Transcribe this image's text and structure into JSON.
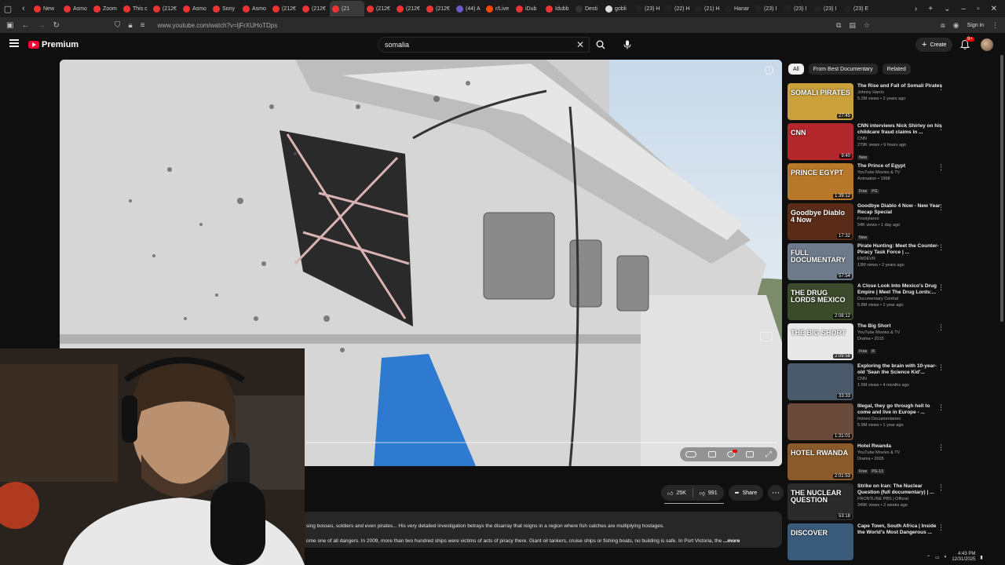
{
  "browser": {
    "tabs": [
      {
        "label": "New",
        "color": "#e33"
      },
      {
        "label": "Asmo",
        "color": "#e33"
      },
      {
        "label": "Zoom",
        "color": "#e33"
      },
      {
        "label": "This c",
        "color": "#e33"
      },
      {
        "label": "(212€",
        "color": "#e33"
      },
      {
        "label": "Asmo",
        "color": "#e33"
      },
      {
        "label": "Sony",
        "color": "#e33"
      },
      {
        "label": "Asmo",
        "color": "#e33"
      },
      {
        "label": "(212€",
        "color": "#e33"
      },
      {
        "label": "(212€",
        "color": "#e33"
      },
      {
        "label": "(21",
        "color": "#e33",
        "active": true
      },
      {
        "label": "(212€",
        "color": "#e33"
      },
      {
        "label": "(212€",
        "color": "#e33"
      },
      {
        "label": "(212€",
        "color": "#e33"
      },
      {
        "label": "(44) A",
        "color": "#6a5acd"
      },
      {
        "label": "r/Live",
        "color": "#ff4500"
      },
      {
        "label": "iDub",
        "color": "#e33"
      },
      {
        "label": "Idubb",
        "color": "#e33"
      },
      {
        "label": "Desti",
        "color": "#333"
      },
      {
        "label": "gobli",
        "color": "#ddd"
      },
      {
        "label": "(23) H",
        "color": "#222"
      },
      {
        "label": "(22) H",
        "color": "#222"
      },
      {
        "label": "(21) H",
        "color": "#222"
      },
      {
        "label": "Hanar",
        "color": "#222"
      },
      {
        "label": "(23) I",
        "color": "#222"
      },
      {
        "label": "(23) I",
        "color": "#222"
      },
      {
        "label": "(23) I",
        "color": "#222"
      },
      {
        "label": "(23) E",
        "color": "#222"
      }
    ],
    "url": "www.youtube.com/watch?v=ljFrXUHoTDps",
    "signin": "Sign in"
  },
  "masthead": {
    "logo": "Premium",
    "search_value": "somalia",
    "create": "Create",
    "notifications": "9+"
  },
  "player": {
    "info": "i"
  },
  "actions": {
    "likes": "25K",
    "dislikes": "991",
    "share": "Share"
  },
  "description": {
    "line1": "sing bosses, soldiers and even pirates... His very detailed investigation betrays the disarray that reigns in a region where fish catches are multiplying hostages.",
    "line2": "ome one of all dangers. In 2009, more than two hundred ships were victims of acts of piracy there. Giant oil tankers, cruise ships or fishing boats, no building is safe. In Port Victoria, the",
    "more": "...more"
  },
  "chips": [
    "All",
    "From Best Documentary",
    "Related"
  ],
  "recommendations": [
    {
      "title": "The Rise and Fall of Somali Pirates",
      "channel": "Johnny Harris",
      "meta": "5.2M views • 2 years ago",
      "duration": "27:45",
      "badges": [],
      "thumb_text": "SOMALI PIRATES",
      "thumb_bg": "#c9a03a"
    },
    {
      "title": "CNN interviews Nick Shirley on his childcare fraud claims in ...",
      "channel": "CNN",
      "meta": "279K views • 9 hours ago",
      "duration": "9:40",
      "badges": [
        "New"
      ],
      "thumb_text": "CNN",
      "thumb_bg": "#b3262b"
    },
    {
      "title": "The Prince of Egypt",
      "channel": "YouTube Movies & TV",
      "meta": "Animation • 1998",
      "duration": "1:39:12",
      "badges": [
        "Free",
        "PG"
      ],
      "thumb_text": "PRINCE EGYPT",
      "thumb_bg": "#b8782a"
    },
    {
      "title": "Goodbye Diablo 4 Now - New Year Recap Special",
      "channel": "Frostylaroo",
      "meta": "54K views • 1 day ago",
      "duration": "17:32",
      "badges": [
        "New"
      ],
      "thumb_text": "Goodbye Diablo 4 Now",
      "thumb_bg": "#5a2b18"
    },
    {
      "title": "Pirate Hunting: Meet the Counter-Piracy Task Force | ...",
      "channel": "ENDEVR",
      "meta": "13M views • 2 years ago",
      "duration": "57:54",
      "badges": [],
      "thumb_text": "FULL DOCUMENTARY",
      "thumb_bg": "#6d7a8a"
    },
    {
      "title": "A Close Look Into Mexico's Drug Empire | Meet The Drug Lords:...",
      "channel": "Documentary Central",
      "meta": "5.8M views • 1 year ago",
      "duration": "2:08:12",
      "badges": [],
      "thumb_text": "THE DRUG LORDS MEXICO",
      "thumb_bg": "#3b4a2a"
    },
    {
      "title": "The Big Short",
      "channel": "YouTube Movies & TV",
      "meta": "Drama • 2015",
      "duration": "2:09:58",
      "badges": [
        "Free",
        "R"
      ],
      "thumb_text": "THE BIG SHORT",
      "thumb_bg": "#e8e8e8"
    },
    {
      "title": "Exploring the brain with 10-year-old 'Sean the Science Kid'...",
      "channel": "CNN",
      "meta": "1.6M views • 4 months ago",
      "duration": "33:33",
      "badges": [],
      "thumb_text": "",
      "thumb_bg": "#4a5a6a"
    },
    {
      "title": "Illegal, they go through hell to come and live in Europe - ...",
      "channel": "Imineo Documentaries",
      "meta": "5.9M views • 1 year ago",
      "duration": "1:31:01",
      "badges": [],
      "thumb_text": "",
      "thumb_bg": "#6a4a3a"
    },
    {
      "title": "Hotel Rwanda",
      "channel": "YouTube Movies & TV",
      "meta": "Drama • 2005",
      "duration": "2:01:53",
      "badges": [
        "Free",
        "PG-13"
      ],
      "thumb_text": "HOTEL RWANDA",
      "thumb_bg": "#8a5a2a"
    },
    {
      "title": "Strike on Iran: The Nuclear Question (full documentary) | ...",
      "channel": "FRONTLINE PBS | Official",
      "meta": "349K views • 2 weeks ago",
      "duration": "53:18",
      "badges": [],
      "thumb_text": "THE NUCLEAR QUESTION",
      "thumb_bg": "#2a2a2a"
    },
    {
      "title": "Cape Town, South Africa | Inside the World's Most Dangerous ...",
      "channel": "",
      "meta": "",
      "duration": "",
      "badges": [],
      "thumb_text": "DISCOVER",
      "thumb_bg": "#3a5a7a"
    }
  ],
  "tray": {
    "time": "4:43 PM",
    "date": "12/31/2025"
  }
}
